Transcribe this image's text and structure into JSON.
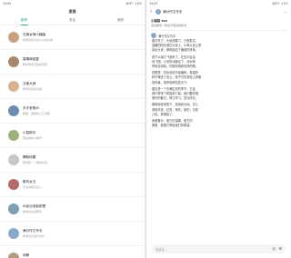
{
  "status": {
    "time": "14:03",
    "icons": "WiFi 100"
  },
  "left_header": {
    "title": "发现"
  },
  "tabs": [
    {
      "label": "推荐"
    },
    {
      "label": "关注"
    },
    {
      "label": "我的"
    }
  ],
  "conversations": [
    {
      "name": "文案女神小蹊蹊",
      "preview": "帮你写出打动人心的文案",
      "color": "#c9a27e"
    },
    {
      "name": "高情商回复",
      "preview": "教你如何高情商回复",
      "color": "#a88a6b"
    },
    {
      "name": "文案大师",
      "preview": "帮你写出好文案",
      "color": "#d7b48f"
    },
    {
      "name": "天才老爸AI",
      "preview": "聪明、幽默的人工智能",
      "color": "#6e8bb0"
    },
    {
      "name": "小智助手",
      "preview": "我是你的小助手",
      "color": "#9fb07d"
    },
    {
      "name": "爆款标题",
      "preview": "帮你起一个爆款标题",
      "color": "#c7c7c7"
    },
    {
      "name": "聊天女王",
      "preview": "专业的聊天达人",
      "color": "#b86a6a"
    },
    {
      "name": "AI创业老板助理",
      "preview": "你的创业好帮手",
      "color": "#7e9eb4"
    },
    {
      "name": "满分作文写手",
      "preview": "帮你写出满分作文",
      "color": "#8aa9c7"
    },
    {
      "name": "闲聊",
      "preview": "随便聊聊",
      "color": "#b39a7c"
    }
  ],
  "right_header": {
    "title": "满分作文写手"
  },
  "source": {
    "name": "小蹊蹊 xxx",
    "question": "请为我写一篇关于春天的作文"
  },
  "reply": {
    "bot_name": "满分作文写手",
    "paragraphs": [
      [
        "春天来了，大地苏醒了，万物复苏。",
        "温暖的阳光洒在大地上，小草从泥土里",
        "探出头来，柳树抽出了嫩绿的枝条。"
      ],
      [
        "燕子从南方飞回来了，在空中自由",
        "地飞翔，小河的冰融化了，河水哗",
        "哗地流淌着，仿佛在唱着欢快的歌。"
      ],
      [
        "田野里，农民伯伯开始播种，希望的",
        "种子撒进了泥土。孩子们在草地上奔跑",
        "放风筝，笑声回荡在蓝天下。"
      ],
      [
        "春天是一个充满生机的季节，它给",
        "我们带来了希望和力量。我们要珍惜",
        "美好的春光，努力学习，茁壮成长。"
      ],
      [
        "春雨轻轻地落下，滋润着大地。花儿",
        "竞相开放，红的、黄的、紫的，五颜",
        "六色，美丽极了。"
      ],
      [
        "我爱春天，爱它的温暖，爱它的",
        "美丽，更爱它带给我们的希望。"
      ]
    ]
  },
  "composer": {
    "placeholder": "发消息..."
  }
}
